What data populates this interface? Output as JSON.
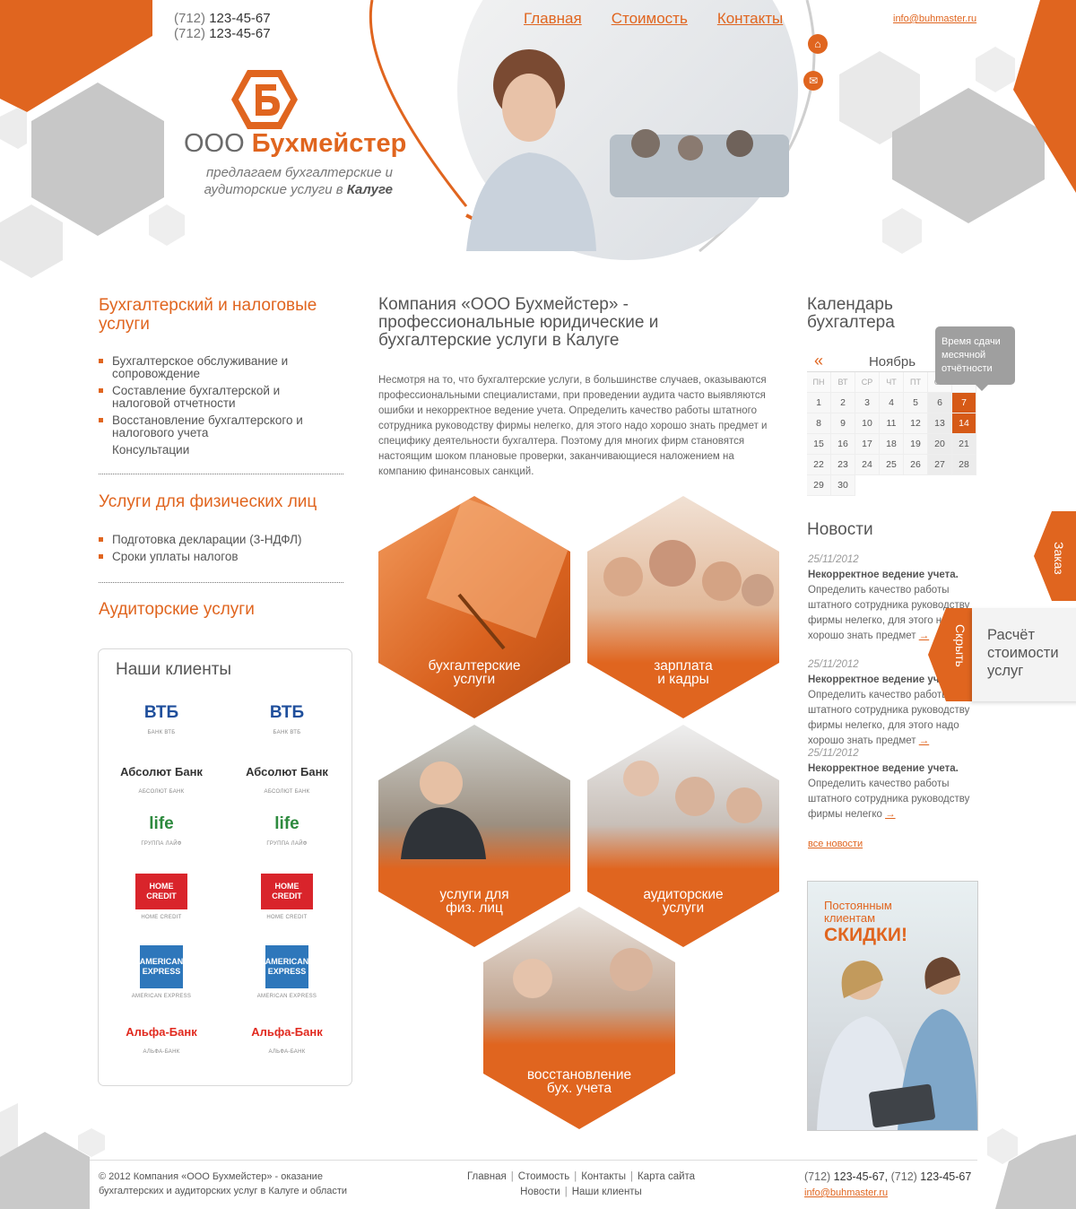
{
  "header": {
    "phones": [
      {
        "code": "(712)",
        "number": "123-45-67"
      },
      {
        "code": "(712)",
        "number": "123-45-67"
      }
    ],
    "nav": [
      "Главная",
      "Стоимость",
      "Контакты"
    ],
    "email": "info@buhmaster.ru",
    "logo": {
      "prefix": "ООО",
      "name": "Бухмейстер"
    },
    "tagline": {
      "line1": "предлагаем бухгалтерские и",
      "line2": "аудиторские услуги в",
      "city": "Калуге"
    }
  },
  "left": {
    "sections": [
      {
        "title": "Бухгалтерский и налоговые услуги",
        "items": [
          "Бухгалтерское обслуживание и сопровождение",
          "Составление бухгалтерской и налоговой отчетности",
          "Восстановление бухгалтерского и налогового учета",
          "Консультации"
        ]
      },
      {
        "title": "Услуги для физических лиц",
        "items": [
          "Подготовка декларации (3-НДФЛ)",
          "Сроки уплаты налогов"
        ]
      },
      {
        "title": "Аудиторские услуги",
        "items": []
      }
    ],
    "clients": {
      "title": "Наши клиенты",
      "logos": [
        {
          "mark": "ВТБ",
          "sub": "БАНК ВТБ",
          "color": "#1f4f9c"
        },
        {
          "mark": "Абсолют Банк",
          "sub": "АБСОЛЮТ БАНК",
          "color": "#333333"
        },
        {
          "mark": "life",
          "sub": "ГРУППА ЛАЙФ",
          "color": "#2d8a3e"
        },
        {
          "mark": "HOME CREDIT",
          "sub": "HOME CREDIT",
          "color": "#d9242b"
        },
        {
          "mark": "AMERICAN EXPRESS",
          "sub": "AMERICAN EXPRESS",
          "color": "#2e77bb"
        },
        {
          "mark": "Альфа-Банк",
          "sub": "АЛЬФА-БАНК",
          "color": "#e12a1f"
        }
      ]
    }
  },
  "center": {
    "title": "Компания «ООО Бухмейстер» - профессиональные юридические и бухгалтерские услуги в Калуге",
    "text": "Несмотря на то, что бухгалтерские услуги, в большинстве случаев, оказываются профессиональными специалистами, при проведении аудита часто выявляются ошибки и некорректное ведение учета. Определить качество работы штатного сотрудника руководству фирмы нелегко, для этого надо хорошо знать предмет и специфику деятельности бухгалтера. Поэтому для многих фирм становятся настоящим шоком плановые проверки, заканчивающиеся наложением на компанию финансовых санкций.",
    "tiles": [
      {
        "line1": "бухгалтерские",
        "line2": "услуги"
      },
      {
        "line1": "зарплата",
        "line2": "и кадры"
      },
      {
        "line1": "услуги для",
        "line2": "физ. лиц"
      },
      {
        "line1": "аудиторские",
        "line2": "услуги"
      },
      {
        "line1": "восстановление",
        "line2": "бух. учета"
      }
    ]
  },
  "calendar": {
    "title": "Календарь бухгалтера",
    "month": "Ноябрь",
    "prev": "«",
    "tooltip": "Время сдачи месячной отчётности",
    "weekdays": [
      "ПН",
      "ВТ",
      "СР",
      "ЧТ",
      "ПТ",
      "СБ",
      "ВС"
    ],
    "days": [
      "1",
      "2",
      "3",
      "4",
      "5",
      "6",
      "7",
      "8",
      "9",
      "10",
      "11",
      "12",
      "13",
      "14",
      "15",
      "16",
      "17",
      "18",
      "19",
      "20",
      "21",
      "22",
      "23",
      "24",
      "25",
      "26",
      "27",
      "28",
      "29",
      "30"
    ],
    "first_weekday": 1,
    "highlighted": [
      "7",
      "14"
    ]
  },
  "news": {
    "title": "Новости",
    "items": [
      {
        "date": "25/11/2012",
        "head": "Некорректное ведение учета.",
        "text": "Определить качество работы штатного сотрудника руководству фирмы нелегко, для этого надо хорошо знать предмет",
        "more": "→"
      },
      {
        "date": "25/11/2012",
        "head": "Некорректное ведение учета.",
        "text": "Определить качество работы штатного сотрудника руководству фирмы нелегко, для этого надо хорошо знать предмет",
        "more": "→"
      },
      {
        "date": "25/11/2012",
        "head": "Некорректное ведение учета.",
        "text": "Определить качество работы штатного сотрудника руководству фирмы нелегко",
        "more": "→"
      }
    ],
    "all": "все новости"
  },
  "promo": {
    "line1": "Постоянным клиентам",
    "line2": "СКИДКИ!"
  },
  "side": {
    "order": "Заказ",
    "hide": "Скрыть",
    "calc": "Расчёт стоимости услуг"
  },
  "footer": {
    "copyright": "© 2012 Компания «ООО Бухмейстер» - оказание бухгалтерских и аудиторских услуг в Калуге и области",
    "nav_row1": [
      "Главная",
      "Стоимость",
      "Контакты",
      "Карта сайта"
    ],
    "nav_row2": [
      "Новости",
      "Наши клиенты"
    ],
    "phone1": {
      "code": "(712)",
      "number": "123-45-67"
    },
    "phone2": {
      "code": "(712)",
      "number": "123-45-67"
    },
    "email": "info@buhmaster.ru"
  },
  "colors": {
    "accent": "#e0651f",
    "grey_hex": "#c8c8c8",
    "light_hex": "#ededed"
  }
}
